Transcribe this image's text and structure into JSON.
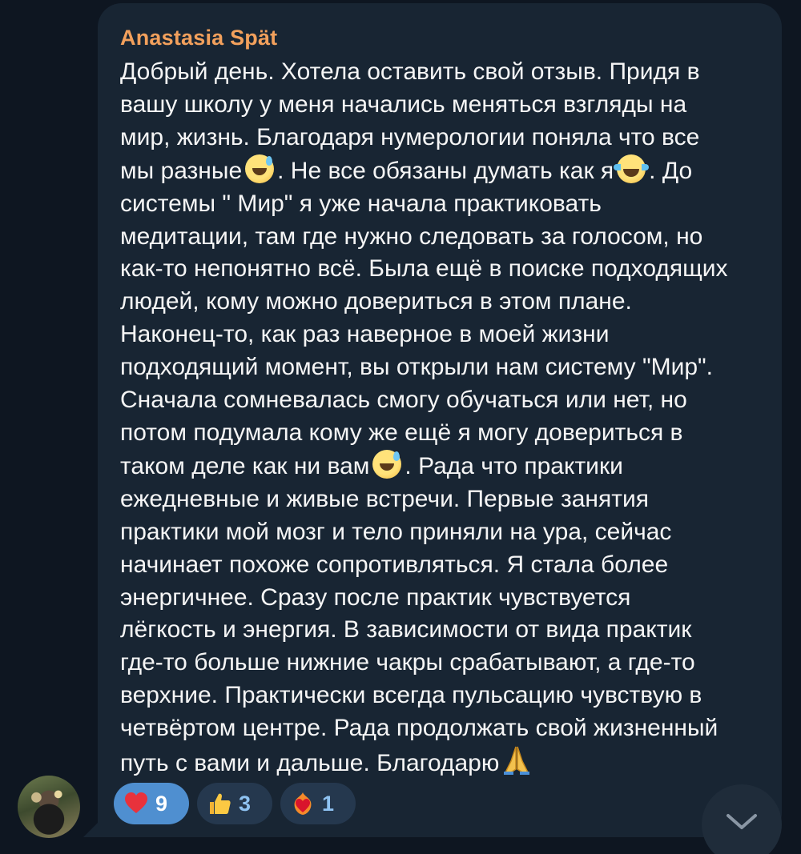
{
  "message": {
    "sender": "Anastasia Spät",
    "lines": [
      [
        "Добрый день. Хотела оставить свой отзыв. Придя в"
      ],
      [
        "вашу школу у меня начались меняться взгляды на"
      ],
      [
        "мир, жизнь. Благодаря нумерологии поняла что все"
      ],
      [
        "мы разные",
        "emoji:sweat-smile",
        ". Не все обязаны думать как я",
        "emoji:joy",
        ". До"
      ],
      [
        "системы \" Мир\" я уже начала практиковать"
      ],
      [
        "медитации, там где нужно следовать за голосом, но"
      ],
      [
        "как-то непонятно всё. Была ещё в поиске подходящих"
      ],
      [
        "людей, кому можно довериться в этом плане."
      ],
      [
        "Наконец-то, как раз наверное в моей жизни"
      ],
      [
        "подходящий момент, вы открыли нам систему \"Мир\"."
      ],
      [
        "Сначала сомневалась смогу обучаться или нет, но"
      ],
      [
        "потом подумала кому же ещё я могу довериться в"
      ],
      [
        "таком деле как ни вам",
        "emoji:sweat-smile",
        ". Рада что практики"
      ],
      [
        "ежедневные и живые встречи. Первые занятия"
      ],
      [
        "практики мой мозг и тело приняли на ура, сейчас"
      ],
      [
        "начинает похоже сопротивляться. Я стала более"
      ],
      [
        "энергичнее. Сразу после практик чувствуется"
      ],
      [
        "лёгкость и энергия. В зависимости от вида практик"
      ],
      [
        "где-то больше нижние чакры срабатывают, а где-то"
      ],
      [
        "верхние. Практически всегда пульсацию чувствую в"
      ],
      [
        "четвёртом центре. Рада продолжать свой жизненный"
      ],
      [
        "путь с вами и дальше. Благодарю",
        "emoji:pray"
      ]
    ],
    "reactions": [
      {
        "icon": "heart-icon",
        "count": "9",
        "active": true
      },
      {
        "icon": "thumbs-up-icon",
        "count": "3",
        "active": false
      },
      {
        "icon": "heart-on-fire-icon",
        "count": "1",
        "active": false
      }
    ]
  },
  "colors": {
    "background": "#0e1621",
    "bubble": "#182533",
    "sender": "#f2a05c",
    "text": "#f5f5f5",
    "reaction_active": "#4f8fd0",
    "reaction_inactive": "#25384e"
  },
  "scroll_button": {
    "icon": "chevron-down-icon"
  }
}
